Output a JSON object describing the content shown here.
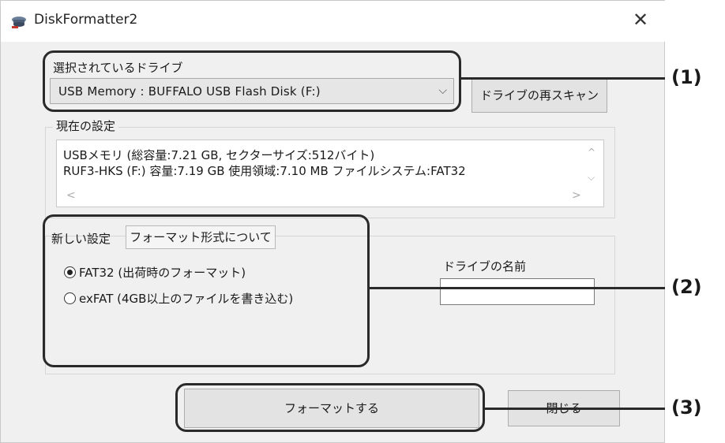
{
  "window": {
    "title": "DiskFormatter2",
    "close_glyph": "✕",
    "app_icon": "disk-formatter-icon"
  },
  "drive": {
    "section_label": "選択されているドライブ",
    "selected_value": "USB Memory : BUFFALO  USB Flash Disk   (F:)",
    "chevron": "⌵",
    "rescan_label": "ドライブの再スキャン"
  },
  "current": {
    "section_label": "現在の設定",
    "lines": [
      "USBメモリ (総容量:7.21 GB, セクターサイズ:512バイト)",
      "  RUF3-HKS (F:)      容量:7.19 GB  使用領域:7.10 MB  ファイルシステム:FAT32"
    ],
    "scroll": {
      "up": "^",
      "down": "⌵",
      "left": "<",
      "right": ">"
    }
  },
  "new_settings": {
    "section_label": "新しい設定",
    "format_info_tab": "フォーマット形式について",
    "options": [
      {
        "label": "FAT32 (出荷時のフォーマット)",
        "selected": true
      },
      {
        "label": "exFAT (4GB以上のファイルを書き込む)",
        "selected": false
      }
    ],
    "drive_name_label": "ドライブの名前",
    "drive_name_value": ""
  },
  "actions": {
    "format_label": "フォーマットする",
    "close_label": "閉じる"
  },
  "annotations": {
    "m1": "(1)",
    "m2": "(2)",
    "m3": "(3)"
  }
}
